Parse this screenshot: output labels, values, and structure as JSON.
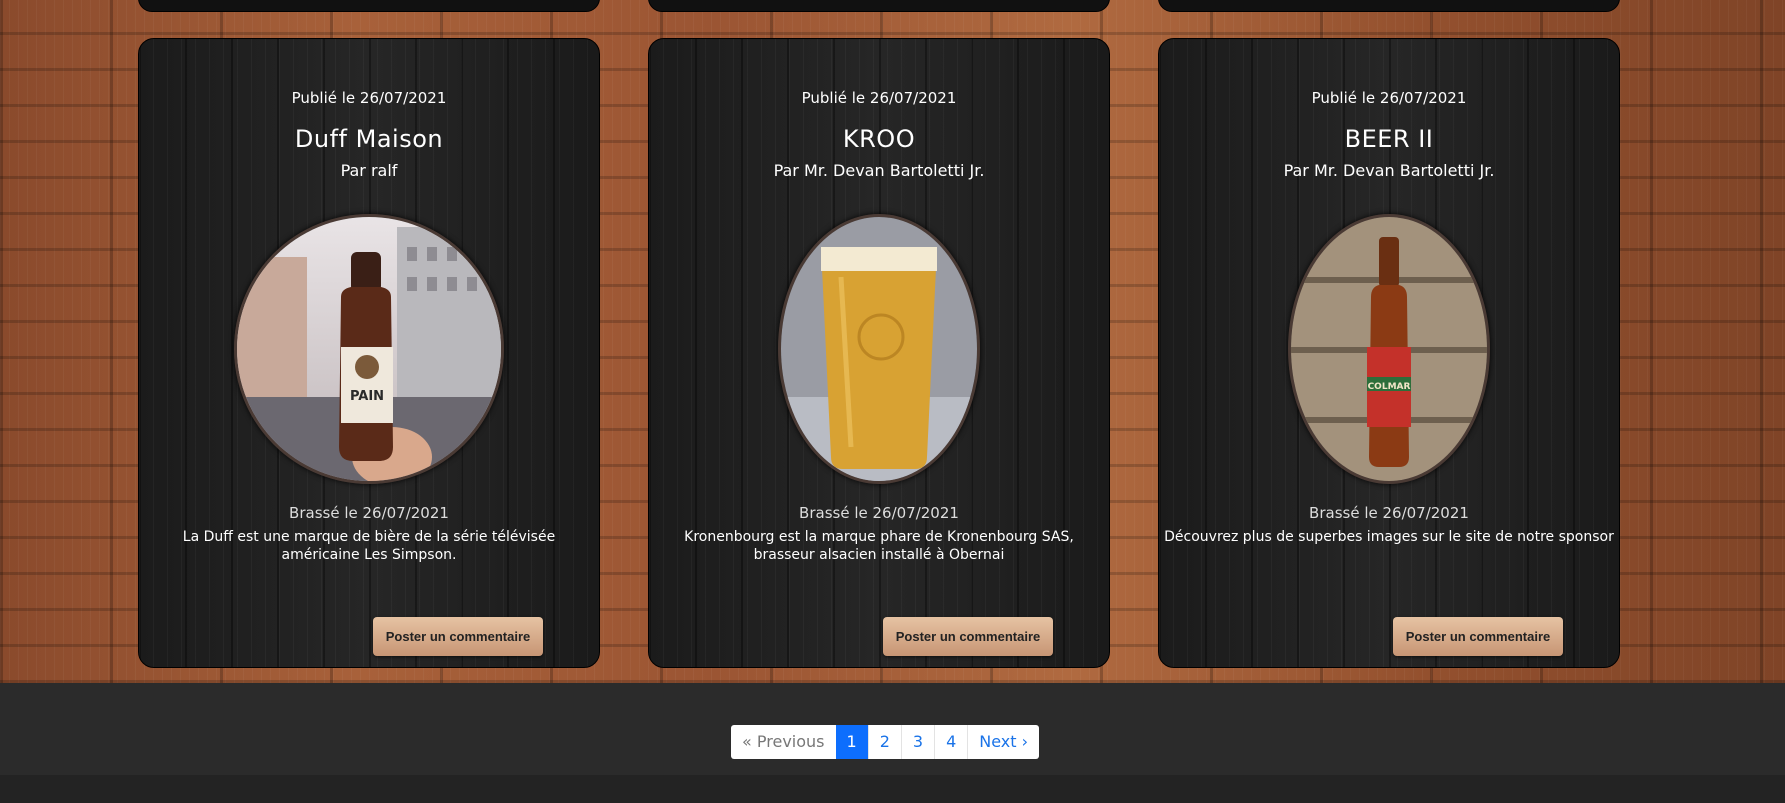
{
  "cards": [
    {
      "published": "Publié le 26/07/2021",
      "title": "Duff Maison",
      "author": "Par ralf",
      "brewed": "Brassé le 26/07/2021",
      "description": "La Duff est une marque de bière de la série télévisée américaine Les Simpson.",
      "comment_label": "Poster un commentaire",
      "label_text": "PAIN"
    },
    {
      "published": "Publié le 26/07/2021",
      "title": "KROO",
      "author": "Par Mr. Devan Bartoletti Jr.",
      "brewed": "Brassé le 26/07/2021",
      "description": "Kronenbourg est la marque phare de Kronenbourg SAS, brasseur alsacien installé à Obernai",
      "comment_label": "Poster un commentaire"
    },
    {
      "published": "Publié le 26/07/2021",
      "title": "BEER II",
      "author": "Par Mr. Devan Bartoletti Jr.",
      "brewed": "Brassé le 26/07/2021",
      "description": "Découvrez plus de superbes images sur le site de notre sponsor",
      "comment_label": "Poster un commentaire",
      "label_text": "COLMAR"
    }
  ],
  "pagination": {
    "previous": "« Previous",
    "pages": [
      "1",
      "2",
      "3",
      "4"
    ],
    "active_page": "1",
    "next": "Next ›"
  },
  "colors": {
    "button": "#d9b08f",
    "active_page": "#0d6efd",
    "footer": "#2b2b2b"
  }
}
